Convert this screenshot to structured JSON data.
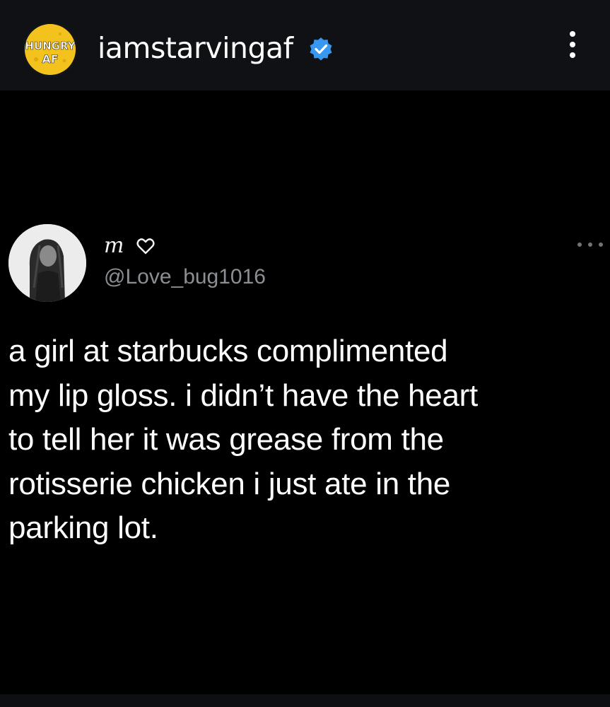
{
  "post_header": {
    "avatar_text_line1": "HUNGRY",
    "avatar_text_line2": "AF",
    "username": "iamstarvingaf",
    "verified": true,
    "icons": {
      "verified": "verified-badge-icon",
      "more": "more-vertical-icon"
    }
  },
  "tweet": {
    "display_name": "m",
    "name_icon": "heart-outline-icon",
    "handle": "@Love_bug1016",
    "more_icon": "more-horizontal-icon",
    "text": "a girl at starbucks complimented\nmy lip gloss. i didn’t have the heart\nto tell her it was grease from the\nrotisserie chicken i just ate in the\nparking lot."
  },
  "colors": {
    "background": "#000000",
    "header_background": "#0f1115",
    "verified_blue": "#3897f0",
    "avatar_yellow": "#f4c21c",
    "handle_gray": "#8b8f94",
    "text_white": "#ffffff"
  }
}
